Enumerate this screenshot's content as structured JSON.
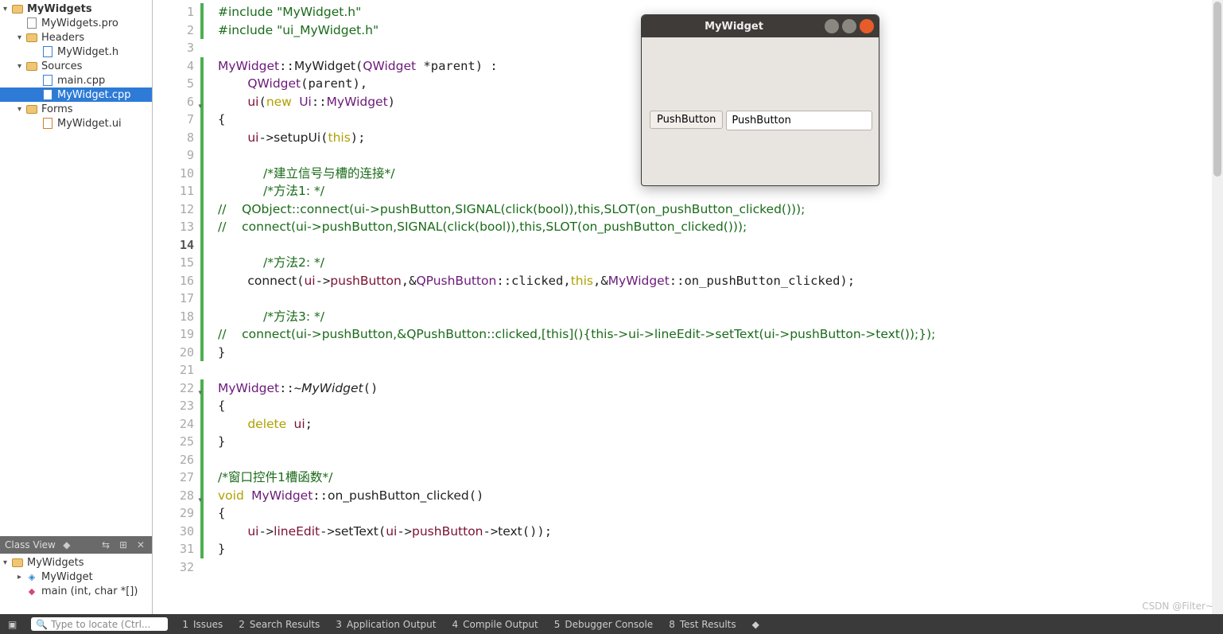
{
  "project_tree": {
    "root": "MyWidgets",
    "pro": "MyWidgets.pro",
    "headers_label": "Headers",
    "header_file": "MyWidget.h",
    "sources_label": "Sources",
    "src_main": "main.cpp",
    "src_widget": "MyWidget.cpp",
    "forms_label": "Forms",
    "form_file": "MyWidget.ui"
  },
  "class_view": {
    "title": "Class View",
    "root": "MyWidgets",
    "class1": "MyWidget",
    "func1": "main (int, char *[])"
  },
  "editor": {
    "current_line": 14,
    "lines": 32
  },
  "code": {
    "l1a": "#include ",
    "l1b": "\"MyWidget.h\"",
    "l2a": "#include ",
    "l2b": "\"ui_MyWidget.h\"",
    "l4": "MyWidget::MyWidget(QWidget *parent) :",
    "l5": "    QWidget(parent),",
    "l6": "    ui(new Ui::MyWidget)",
    "l7": "{",
    "l8": "    ui->setupUi(this);",
    "l10": "    /*建立信号与槽的连接*/",
    "l11": "    /*方法1: */",
    "l12": "//    QObject::connect(ui->pushButton,SIGNAL(click(bool)),this,SLOT(on_pushButton_clicked()));",
    "l13": "//    connect(ui->pushButton,SIGNAL(click(bool)),this,SLOT(on_pushButton_clicked()));",
    "l15": "    /*方法2: */",
    "l16": "    connect(ui->pushButton,&QPushButton::clicked,this,&MyWidget::on_pushButton_clicked);",
    "l18": "    /*方法3: */",
    "l19": "//    connect(ui->pushButton,&QPushButton::clicked,[this](){this->ui->lineEdit->setText(ui->pushButton->text());});",
    "l20": "}",
    "l22": "MyWidget::~MyWidget()",
    "l23": "{",
    "l24": "    delete ui;",
    "l25": "}",
    "l27": "/*窗口控件1槽函数*/",
    "l28": "void MyWidget::on_pushButton_clicked()",
    "l29": "{",
    "l30": "    ui->lineEdit->setText(ui->pushButton->text());",
    "l31": "}"
  },
  "run_window": {
    "title": "MyWidget",
    "button_label": "PushButton",
    "lineedit_text": "PushButton"
  },
  "status": {
    "search_placeholder": "Type to locate (Ctrl...",
    "t1": "1",
    "l1": "Issues",
    "t2": "2",
    "l2": "Search Results",
    "t3": "3",
    "l3": "Application Output",
    "t4": "4",
    "l4": "Compile Output",
    "t5": "5",
    "l5": "Debugger Console",
    "t8": "8",
    "l8": "Test Results"
  },
  "watermark": "CSDN @Filter~"
}
